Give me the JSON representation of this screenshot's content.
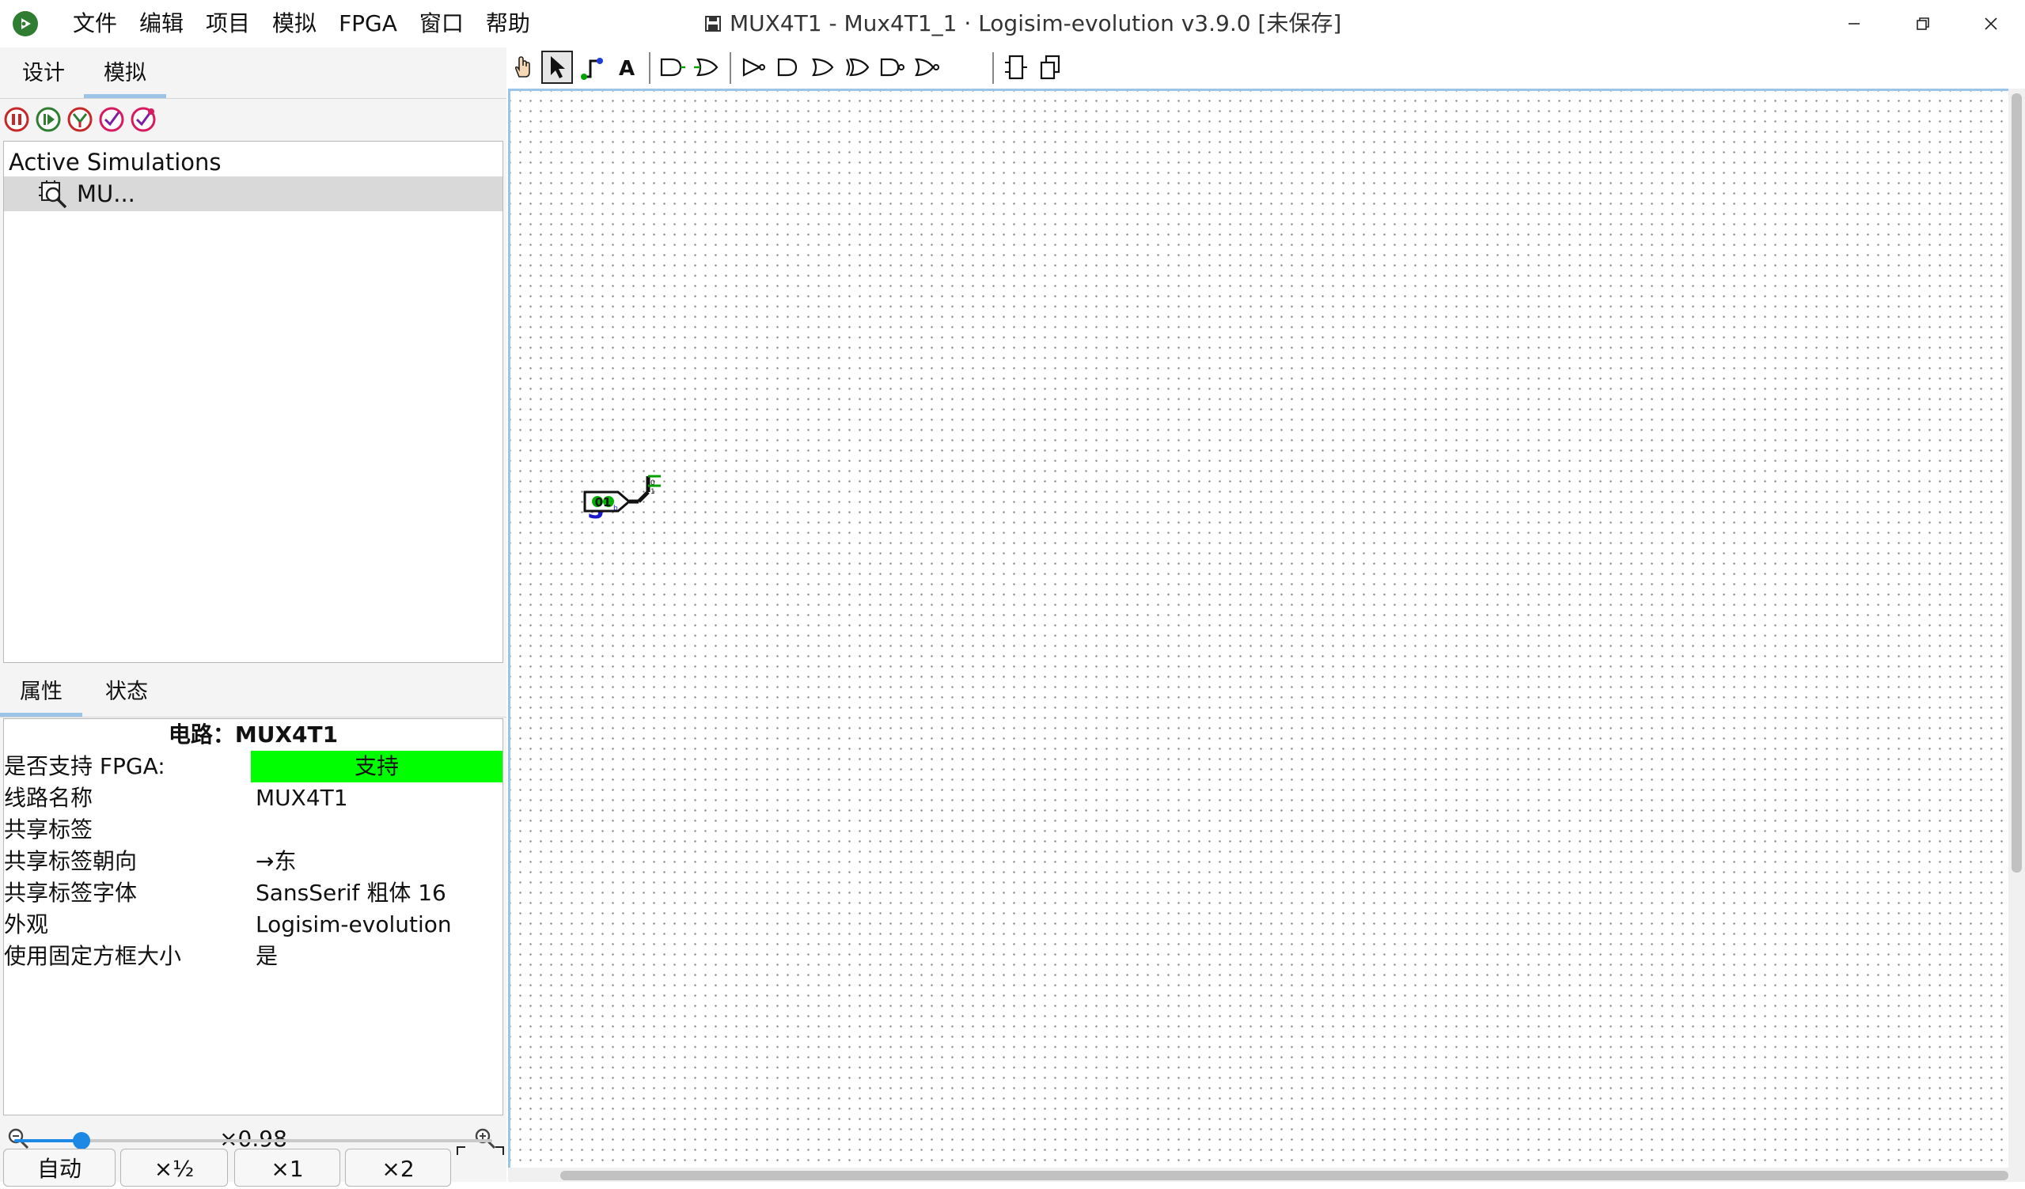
{
  "window": {
    "title": "MUX4T1 - Mux4T1_1 · Logisim-evolution v3.9.0 [未保存]"
  },
  "menu": [
    "文件",
    "编辑",
    "项目",
    "模拟",
    "FPGA",
    "窗口",
    "帮助"
  ],
  "left_tabs": {
    "design": "设计",
    "simulate": "模拟",
    "active": "模拟"
  },
  "sim_tree": {
    "title": "Active Simulations",
    "items": [
      {
        "label": "MU..."
      }
    ]
  },
  "attr_tabs": {
    "properties": "属性",
    "state": "状态",
    "active": "属性"
  },
  "attributes": {
    "header": "电路：MUX4T1",
    "rows": [
      {
        "key": "是否支持 FPGA:",
        "value": "支持",
        "highlight": "#00ff00"
      },
      {
        "key": "线路名称",
        "value": "MUX4T1"
      },
      {
        "key": "共享标签",
        "value": ""
      },
      {
        "key": "共享标签朝向",
        "value": "→东"
      },
      {
        "key": "共享标签字体",
        "value": "SansSerif 粗体 16"
      },
      {
        "key": "外观",
        "value": "Logisim-evolution"
      },
      {
        "key": "使用固定方框大小",
        "value": "是"
      }
    ]
  },
  "zoom": {
    "value": "×0.98",
    "slider_fraction": 0.14,
    "buttons": [
      "自动",
      "×½",
      "×1",
      "×2"
    ]
  },
  "toolbar": {
    "tools": [
      "poke-tool",
      "select-tool",
      "wiring-tool",
      "text-tool",
      "and-gate",
      "or-gate",
      "buffer",
      "not-gate",
      "controlled-buffer",
      "xor-gate",
      "xnor-gate",
      "odd-parity",
      "subcircuit-pin",
      "splitter"
    ],
    "selected": "select-tool"
  },
  "canvas": {
    "component_label": "S",
    "pin_value": "01",
    "splitter_bits": [
      "0",
      "1"
    ]
  },
  "colors": {
    "accent": "#9cc4e8",
    "fpga_supported": "#00ff00",
    "label_blue": "#1a1acc",
    "wire_green": "#00a000"
  }
}
